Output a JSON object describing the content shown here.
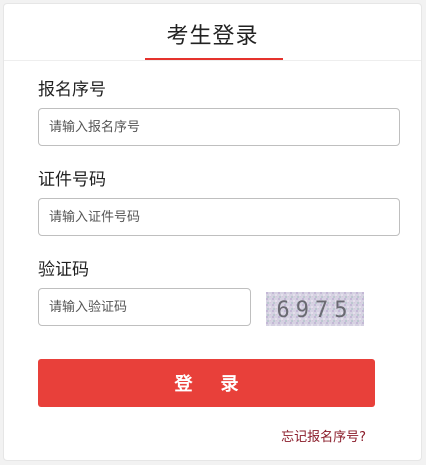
{
  "form": {
    "title": "考生登录",
    "accent_color": "#e5322d",
    "fields": {
      "exam_no": {
        "label": "报名序号",
        "placeholder": "请输入报名序号",
        "value": ""
      },
      "id_no": {
        "label": "证件号码",
        "placeholder": "请输入证件号码",
        "value": ""
      },
      "captcha": {
        "label": "验证码",
        "placeholder": "请输入验证码",
        "value": "",
        "image_text": "6975"
      }
    },
    "submit_label": "登录",
    "forgot_link": "忘记报名序号?"
  }
}
